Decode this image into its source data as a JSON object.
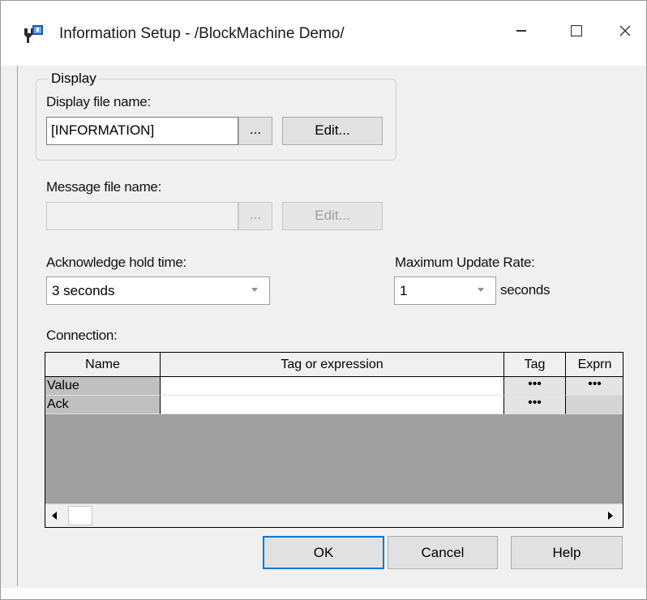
{
  "window": {
    "title": "Information Setup - /BlockMachine Demo/",
    "minimize_icon": "minimize-icon",
    "maximize_icon": "maximize-icon",
    "close_icon": "close-icon"
  },
  "display_group": {
    "title": "Display",
    "file_label": "Display file name:",
    "file_value": "[INFORMATION]",
    "browse_label": "...",
    "edit_label": "Edit..."
  },
  "message": {
    "file_label": "Message file name:",
    "file_value": "",
    "browse_label": "...",
    "edit_label": "Edit..."
  },
  "acknowledge": {
    "label": "Acknowledge hold time:",
    "selected": "3 seconds"
  },
  "update_rate": {
    "label": "Maximum Update Rate:",
    "selected": "1",
    "unit": "seconds"
  },
  "connection": {
    "label": "Connection:",
    "columns": [
      "Name",
      "Tag or expression",
      "Tag",
      "Exprn"
    ],
    "rows": [
      {
        "name": "Value",
        "expression": "",
        "tag_btn": "•••",
        "exprn_btn": "•••"
      },
      {
        "name": "Ack",
        "expression": "",
        "tag_btn": "•••",
        "exprn_btn": ""
      }
    ]
  },
  "buttons": {
    "ok": "OK",
    "cancel": "Cancel",
    "help": "Help"
  },
  "colors": {
    "accent": "#0078d7",
    "face": "#f0f0f0",
    "grid_bg": "#a0a0a0"
  }
}
